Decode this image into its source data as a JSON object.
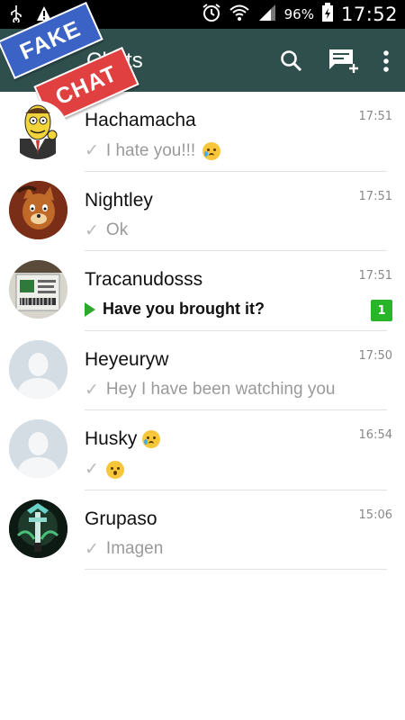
{
  "status_bar": {
    "battery_percent": "96%",
    "time": "17:52",
    "icons": [
      "usb-icon",
      "warning-icon",
      "alarm-icon",
      "wifi-icon",
      "signal-icon",
      "battery-icon"
    ]
  },
  "app_bar": {
    "title": "Chats",
    "actions": [
      "search-icon",
      "new-chat-icon",
      "overflow-menu-icon"
    ]
  },
  "banner": {
    "line1": "FAKE",
    "line2": "CHAT"
  },
  "chats": [
    {
      "name": "Hachamacha",
      "time": "17:51",
      "preview": "I hate you!!!",
      "status": "sent",
      "emoji_after_preview": "crying",
      "avatar": "cartoon-man"
    },
    {
      "name": "Nightley",
      "time": "17:51",
      "preview": "Ok",
      "status": "sent",
      "avatar": "cartoon-fox"
    },
    {
      "name": "Tracanudosss",
      "time": "17:51",
      "preview": "Have you brought it?",
      "status": "voice-unread",
      "unread_count": "1",
      "avatar": "photo"
    },
    {
      "name": "Heyeuryw",
      "time": "17:50",
      "preview": "Hey I have been watching you",
      "status": "sent",
      "avatar": "default"
    },
    {
      "name": "Husky",
      "time": "16:54",
      "preview": "",
      "status": "sent",
      "emoji_after_name": "crying",
      "emoji_preview": "surprised",
      "avatar": "default"
    },
    {
      "name": "Grupaso",
      "time": "15:06",
      "preview": "Imagen",
      "status": "sent",
      "avatar": "game-art"
    }
  ],
  "colors": {
    "app_bar": "#2f4f4d",
    "status_bar": "#000000",
    "unread_badge": "#29b529",
    "fake_ribbon": "#3b63c6",
    "chat_ribbon": "#e04040"
  }
}
